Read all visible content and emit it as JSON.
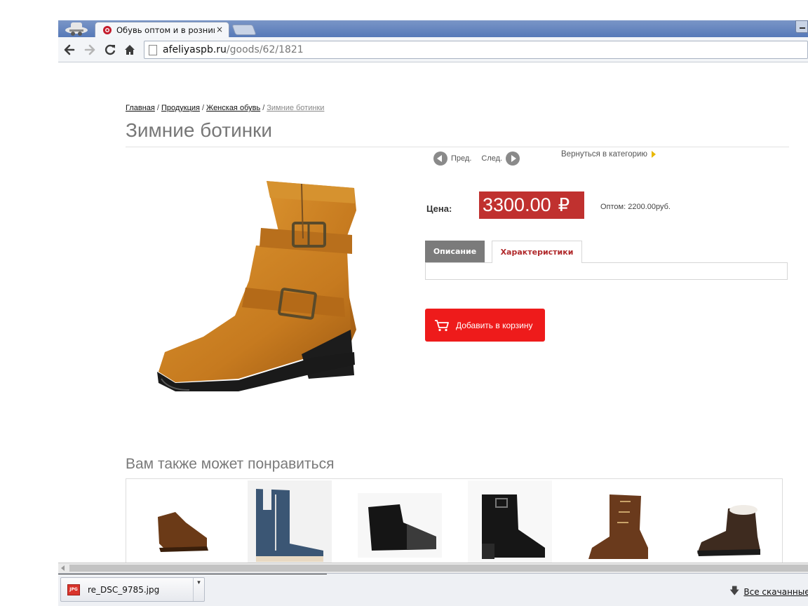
{
  "browser": {
    "tab_title": "Обувь оптом и в розниц",
    "tab_close": "×",
    "url_domain": "afeliyaspb.ru",
    "url_path": "/goods/62/1821"
  },
  "breadcrumb": {
    "items": [
      "Главная",
      "Продукция",
      "Женская обувь"
    ],
    "separator": "/",
    "current": "Зимние ботинки"
  },
  "product": {
    "title": "Зимние ботинки",
    "prev_label": "Пред.",
    "next_label": "След.",
    "back_to_category": "Вернуться в категорию",
    "price_label": "Цена:",
    "price": "3300.00",
    "currency_symbol": "₽",
    "wholesale_price": "Оптом: 2200.00руб.",
    "tabs": [
      "Описание",
      "Характеристики"
    ],
    "add_to_cart": "Добавить в корзину"
  },
  "related": {
    "title": "Вам также может понравиться"
  },
  "downloads": {
    "file_name": "re_DSC_9785.jpg",
    "file_type": "JPG",
    "all_downloads": "Все скачанные ф",
    "dropdown": "▾"
  },
  "colors": {
    "price_bg": "#c0312f",
    "cart_bg": "#ee1b1b",
    "active_tab_text": "#b0282a"
  }
}
